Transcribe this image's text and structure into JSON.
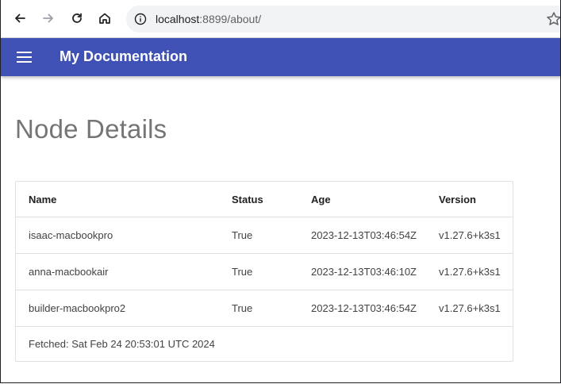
{
  "browser": {
    "url_host": "localhost",
    "url_port_path": ":8899/about/"
  },
  "appbar": {
    "title": "My Documentation"
  },
  "page": {
    "title": "Node Details"
  },
  "table": {
    "columns": [
      "Name",
      "Status",
      "Age",
      "Version"
    ],
    "rows": [
      [
        "isaac-macbookpro",
        "True",
        "2023-12-13T03:46:54Z",
        "v1.27.6+k3s1"
      ],
      [
        "anna-macbookair",
        "True",
        "2023-12-13T03:46:10Z",
        "v1.27.6+k3s1"
      ],
      [
        "builder-macbookpro2",
        "True",
        "2023-12-13T03:46:54Z",
        "v1.27.6+k3s1"
      ]
    ],
    "footer": "Fetched: Sat Feb 24 20:53:01 UTC 2024"
  },
  "icons": {
    "back": "arrow-left-icon",
    "forward": "arrow-right-icon",
    "reload": "reload-icon",
    "home": "home-icon",
    "info": "info-icon",
    "bookmark": "star-icon",
    "menu": "hamburger-menu-icon"
  },
  "colors": {
    "appbar": "#3f51b5",
    "page_title": "#757575",
    "omnibox": "#f1f3f4"
  }
}
